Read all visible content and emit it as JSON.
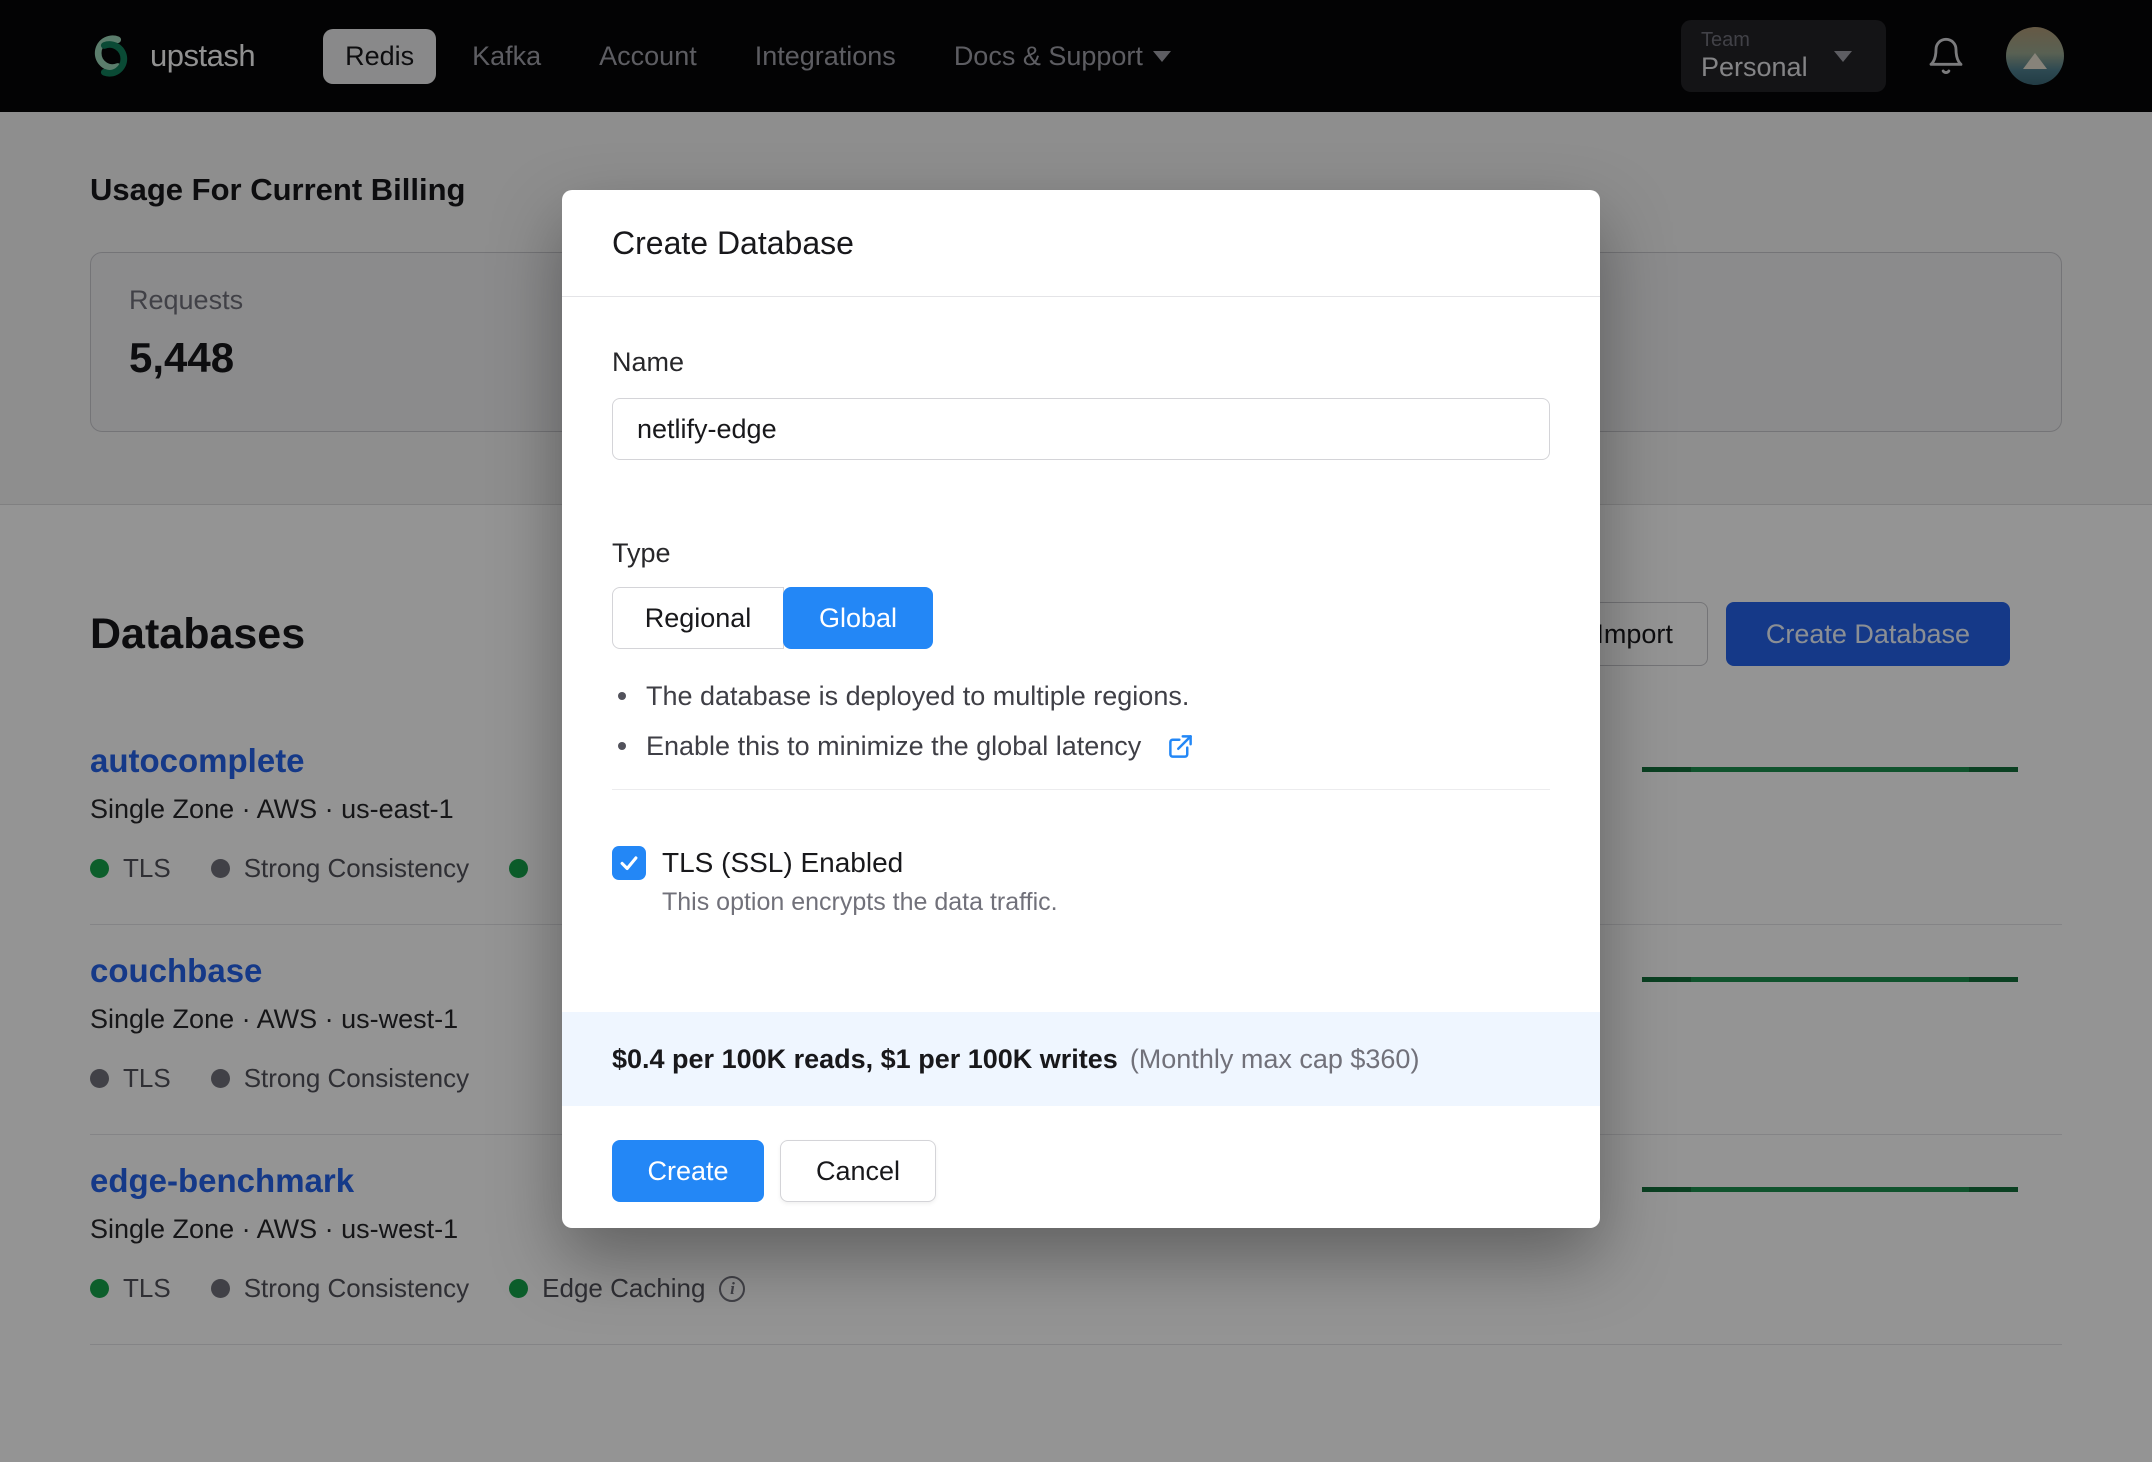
{
  "nav": {
    "brand": "upstash",
    "items": [
      {
        "label": "Redis",
        "active": true
      },
      {
        "label": "Kafka"
      },
      {
        "label": "Account"
      },
      {
        "label": "Integrations"
      },
      {
        "label": "Docs & Support",
        "caret": true
      }
    ],
    "team_label": "Team",
    "team_value": "Personal"
  },
  "usage": {
    "heading": "Usage For Current Billing",
    "requests_label": "Requests",
    "requests_value": "5,448"
  },
  "databases": {
    "heading": "Databases",
    "import_label": "Import",
    "create_label": "Create Database",
    "rows": [
      {
        "name": "autocomplete",
        "meta": "Single Zone · AWS · us-east-1",
        "badges": [
          {
            "label": "TLS",
            "on": true
          },
          {
            "label": "Strong Consistency",
            "on": false
          },
          {
            "label": "",
            "on": true
          }
        ]
      },
      {
        "name": "couchbase",
        "meta": "Single Zone · AWS · us-west-1",
        "badges": [
          {
            "label": "TLS",
            "on": false
          },
          {
            "label": "Strong Consistency",
            "on": false
          }
        ]
      },
      {
        "name": "edge-benchmark",
        "meta": "Single Zone · AWS · us-west-1",
        "badges": [
          {
            "label": "TLS",
            "on": true
          },
          {
            "label": "Strong Consistency",
            "on": false
          },
          {
            "label": "Edge Caching",
            "on": true,
            "info": true
          }
        ]
      }
    ]
  },
  "modal": {
    "title": "Create Database",
    "name_label": "Name",
    "name_value": "netlify-edge",
    "type_label": "Type",
    "type_options": [
      "Regional",
      "Global"
    ],
    "type_selected": "Global",
    "bullets": [
      {
        "text": "The database is deployed to multiple regions."
      },
      {
        "text": "Enable this to minimize the global latency",
        "external_link": true
      }
    ],
    "tls_label": "TLS (SSL) Enabled",
    "tls_checked": true,
    "tls_desc": "This option encrypts the data traffic.",
    "pricing_bold": "$0.4 per 100K reads, $1 per 100K writes",
    "pricing_note": "(Monthly max cap $360)",
    "create_label": "Create",
    "cancel_label": "Cancel"
  },
  "colors": {
    "accent_blue": "#2387f6",
    "link_blue": "#2563eb",
    "badge_green": "#16a34a",
    "badge_gray": "#71717a",
    "banner_bg": "#eff6ff",
    "nav_bg": "#060607"
  }
}
